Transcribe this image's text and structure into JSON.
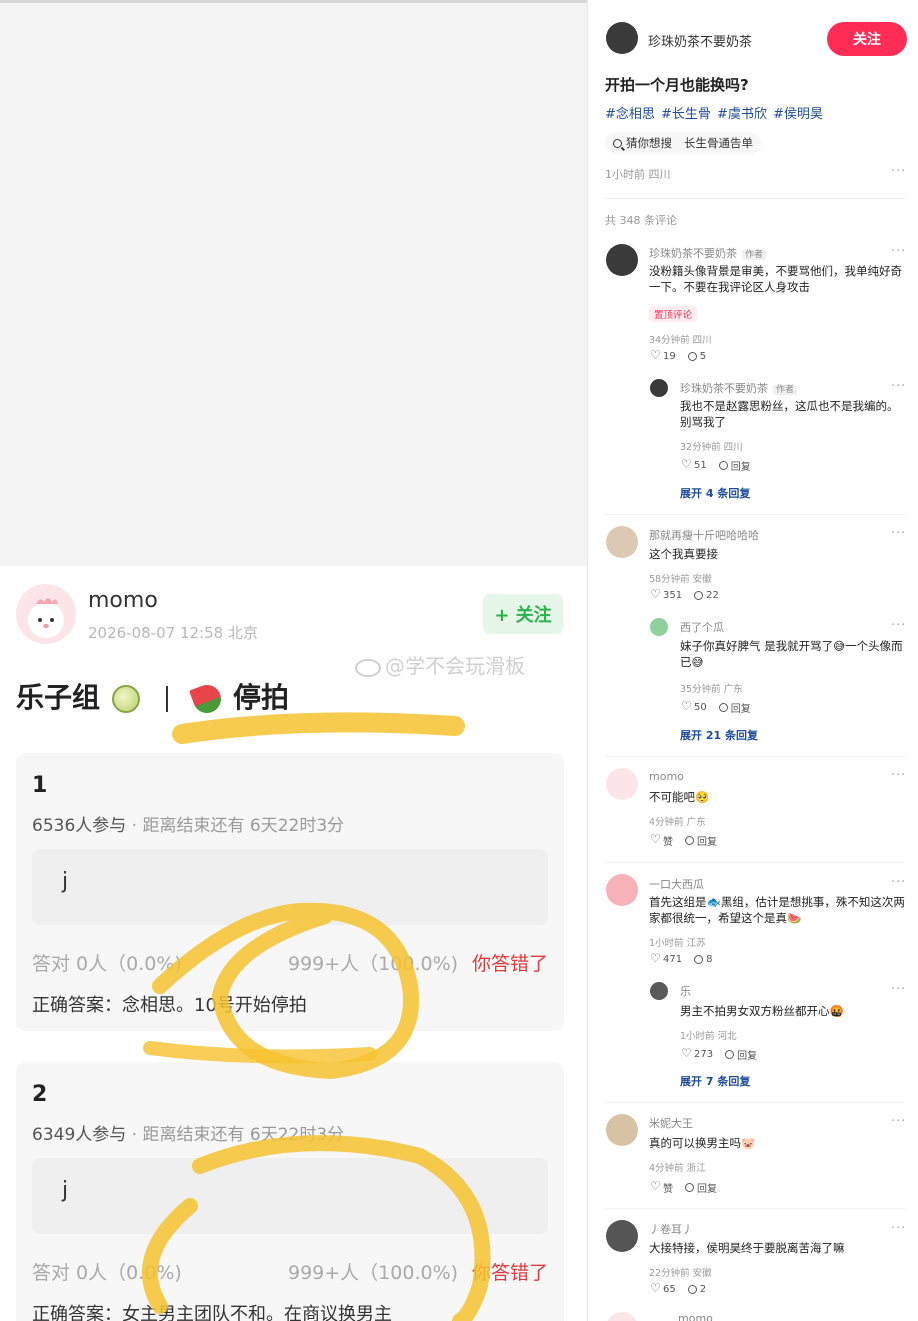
{
  "post": {
    "username": "momo",
    "meta": "2026-08-07 12:58 北京",
    "follow_label": "+ 关注",
    "title_left": "乐子组",
    "title_right": "停拍",
    "watermark": "@学不会玩滑板",
    "quizzes": [
      {
        "number": "1",
        "participants": "6536人参与",
        "deadline": "· 距离结束还有 6天22时3分",
        "option": "j",
        "stat_correct": "答对 0人（0.0%)",
        "stat_total": "999+人（100.0%)",
        "result": "你答错了",
        "answer": "正确答案：念相思。10号开始停拍"
      },
      {
        "number": "2",
        "participants": "6349人参与",
        "deadline": "· 距离结束还有 6天22时3分",
        "option": "j",
        "stat_correct": "答对 0人（0.0%)",
        "stat_total": "999+人（100.0%)",
        "result": "你答错了",
        "answer": "正确答案：女主男主团队不和。在商议换男主"
      }
    ]
  },
  "detail": {
    "author": "珍珠奶茶不要奶茶",
    "follow_label": "关注",
    "title": "开拍一个月也能换吗?",
    "tags": "#念相思 #长生骨 #虞书欣 #侯明昊",
    "search_label": "猜你想搜",
    "search_query": "长生骨通告单",
    "time_location": "1小时前 四川",
    "more": "···",
    "comment_count": "共 348 条评论"
  },
  "comments": {
    "c1": {
      "name": "珍珠奶茶不要奶茶",
      "badge": "作者",
      "text": "没粉籍头像背景是审美，不要骂他们，我单纯好奇一下。不要在我评论区人身攻击",
      "pin": "置顶评论",
      "meta": "34分钟前 四川",
      "likes": "19",
      "replies": "5"
    },
    "c1r": {
      "name": "珍珠奶茶不要奶茶",
      "badge": "作者",
      "text": "我也不是赵露思粉丝，这瓜也不是我编的。别骂我了",
      "meta": "32分钟前 四川",
      "likes": "51",
      "reply_label": "回复",
      "expand": "展开 4 条回复"
    },
    "c2": {
      "name": "那就再瘦十斤吧哈哈哈",
      "text": "这个我真要接",
      "meta": "58分钟前 安徽",
      "likes": "351",
      "replies": "22"
    },
    "c2r": {
      "name": "西了个瓜",
      "text": "妹子你真好脾气 是我就开骂了😅一个头像而已😅",
      "meta": "35分钟前 广东",
      "likes": "50",
      "reply_label": "回复",
      "expand": "展开 21 条回复"
    },
    "c3": {
      "name": "momo",
      "text": "不可能吧🥺",
      "meta": "4分钟前 广东",
      "likes": "赞",
      "reply_label": "回复"
    },
    "c4": {
      "name": "一口大西瓜",
      "text": "首先这组是🐟黑组，估计是想挑事，殊不知这次两家都很统一，希望这个是真🍉",
      "meta": "1小时前 江苏",
      "likes": "471",
      "replies": "8"
    },
    "c4r": {
      "name": "乐",
      "text": "男主不拍男女双方粉丝都开心🤬",
      "meta": "1小时前 河北",
      "likes": "273",
      "reply_label": "回复",
      "expand": "展开 7 条回复"
    },
    "c5": {
      "name": "米妮大王",
      "text": "真的可以换男主吗🐷",
      "meta": "4分钟前 浙江",
      "likes": "赞",
      "reply_label": "回复"
    },
    "c6": {
      "name": "丿卷耳丿",
      "text": "大接特接，侯明昊终于要脱离苦海了嘛",
      "meta": "22分钟前 安徽",
      "likes": "65",
      "replies": "2"
    },
    "c7": {
      "name": "momo"
    }
  },
  "colors": {
    "follow_red": "#ff2c55",
    "follow_green": "#2bb24c",
    "wrong_red": "#e4393c",
    "tag_blue": "#1e4c9a",
    "highlighter": "#f6c22e"
  }
}
